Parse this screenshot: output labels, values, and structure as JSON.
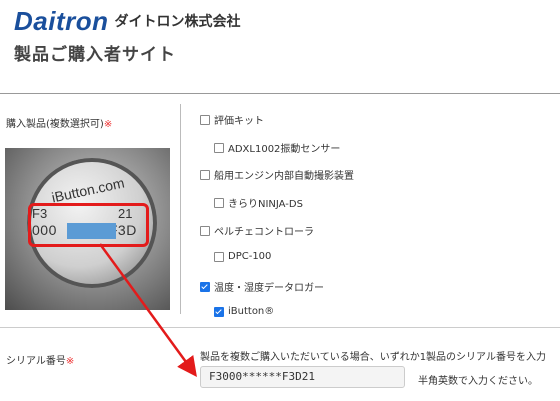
{
  "header": {
    "logo_text": "Daitron",
    "company_jp": "ダイトロン株式会社",
    "title": "製品ご購入者サイト"
  },
  "form": {
    "product_label": "購入製品(複数選択可)",
    "product_required_mark": "※",
    "serial_label": "シリアル番号",
    "serial_required_mark": "※",
    "options": [
      {
        "label": "評価キット",
        "checked": false
      },
      {
        "label": "ADXL1002振動センサー",
        "checked": false
      },
      {
        "label": "船用エンジン内部自動撮影装置",
        "checked": false
      },
      {
        "label": "きらりNINJA-DS",
        "checked": false
      },
      {
        "label": "ペルチェコントローラ",
        "checked": false
      },
      {
        "label": "DPC-100",
        "checked": false
      },
      {
        "label": "温度・湿度データロガー",
        "checked": true
      },
      {
        "label": "iButton®",
        "checked": true
      }
    ],
    "serial_instruction": "製品を複数ご購入いただいている場合、いずれか1製品のシリアル番号を入力",
    "serial_value": "F3000******F3D21",
    "serial_hint": "半角英数で入力ください。"
  },
  "photo": {
    "brand_text": "iButton.com",
    "serial_prefix": "F3",
    "serial_suffix_top": "21",
    "serial_start": "000",
    "serial_end": "F3D"
  },
  "colors": {
    "brand_blue": "#1a4f9c",
    "required_red": "#e33333",
    "annotation_red": "#e31b1b",
    "check_blue": "#1a73e8",
    "mask_blue": "#5b9bd5"
  }
}
